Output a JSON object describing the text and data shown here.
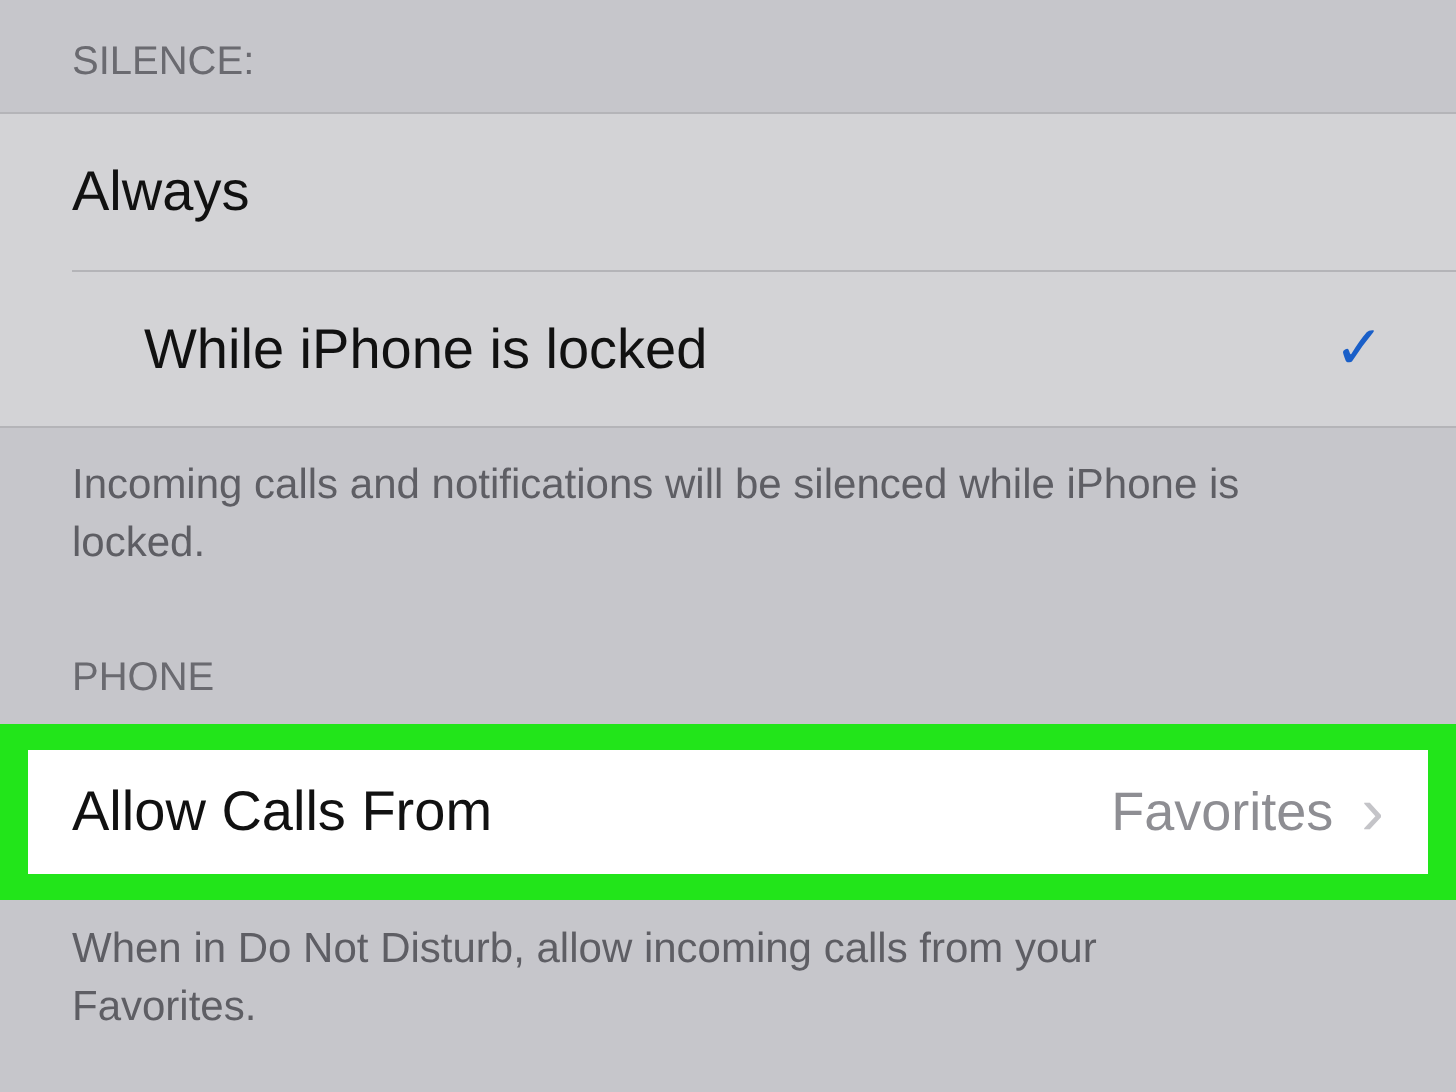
{
  "silence": {
    "header": "SILENCE:",
    "options": [
      {
        "label": "Always",
        "selected": false
      },
      {
        "label": "While iPhone is locked",
        "selected": true
      }
    ],
    "check": "✓",
    "footer": "Incoming calls and notifications will be silenced while iPhone is locked."
  },
  "phone": {
    "header": "PHONE",
    "rows": [
      {
        "label": "Allow Calls From",
        "value": "Favorites",
        "chevron": "›",
        "highlighted": true
      }
    ],
    "footer": "When in Do Not Disturb, allow incoming calls from your Favorites."
  }
}
